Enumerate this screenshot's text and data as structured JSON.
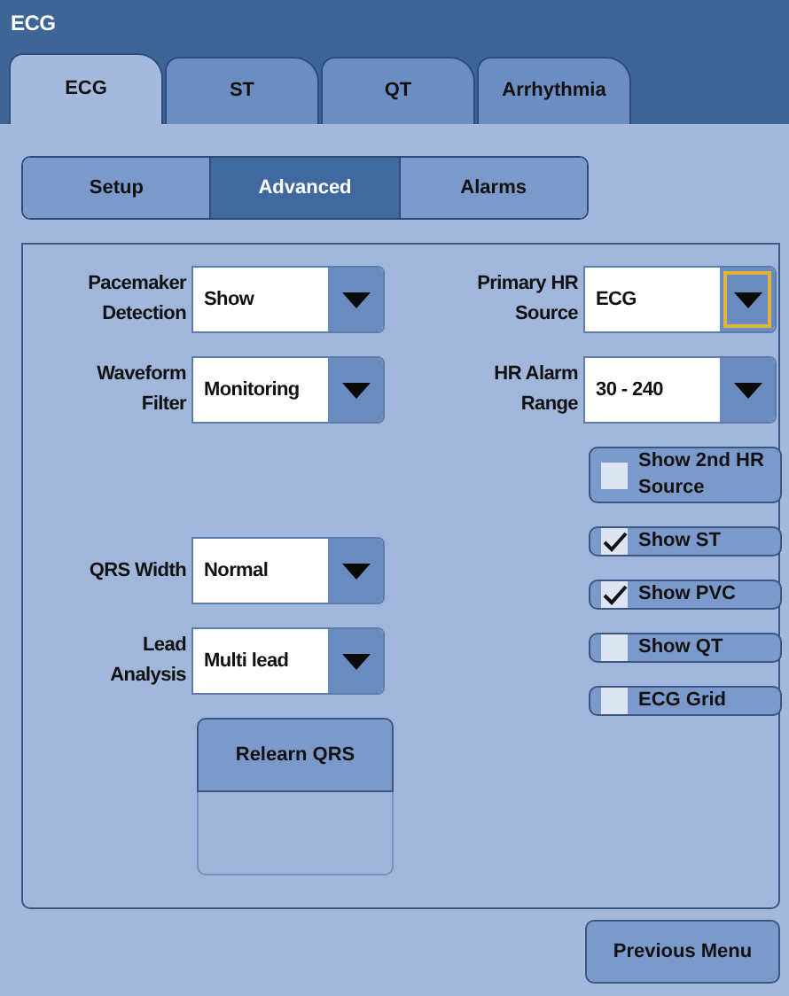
{
  "window": {
    "title": "ECG"
  },
  "tabs": [
    {
      "label": "ECG",
      "selected": true
    },
    {
      "label": "ST",
      "selected": false
    },
    {
      "label": "QT",
      "selected": false
    },
    {
      "label": "Arrhythmia",
      "selected": false
    }
  ],
  "subtabs": [
    {
      "label": "Setup",
      "selected": false
    },
    {
      "label": "Advanced",
      "selected": true
    },
    {
      "label": "Alarms",
      "selected": false
    }
  ],
  "left_groups": [
    [
      {
        "kind": "dropdown",
        "label": "Pacemaker Detection",
        "value": "Show",
        "focused": false
      },
      {
        "kind": "dropdown",
        "label": "Waveform Filter",
        "value": "Monitoring",
        "focused": false
      }
    ],
    [
      {
        "kind": "dropdown",
        "label": "QRS Width",
        "value": "Normal",
        "focused": false
      },
      {
        "kind": "dropdown",
        "label": "Lead Analysis",
        "value": "Multi lead",
        "focused": false
      },
      {
        "kind": "button",
        "label": "Relearn QRS"
      }
    ]
  ],
  "right_items": [
    {
      "kind": "dropdown",
      "label": "Primary HR Source",
      "value": "ECG",
      "focused": true
    },
    {
      "kind": "dropdown",
      "label": "HR Alarm Range",
      "value": "30 - 240",
      "focused": false
    },
    {
      "kind": "checkbox",
      "label": "Show 2nd HR Source",
      "checked": false
    },
    {
      "kind": "checkbox",
      "label": "Show ST",
      "checked": true
    },
    {
      "kind": "checkbox",
      "label": "Show PVC",
      "checked": true
    },
    {
      "kind": "checkbox",
      "label": "Show QT",
      "checked": false
    },
    {
      "kind": "checkbox",
      "label": "ECG Grid",
      "checked": false
    }
  ],
  "footer_button": "Previous Menu"
}
